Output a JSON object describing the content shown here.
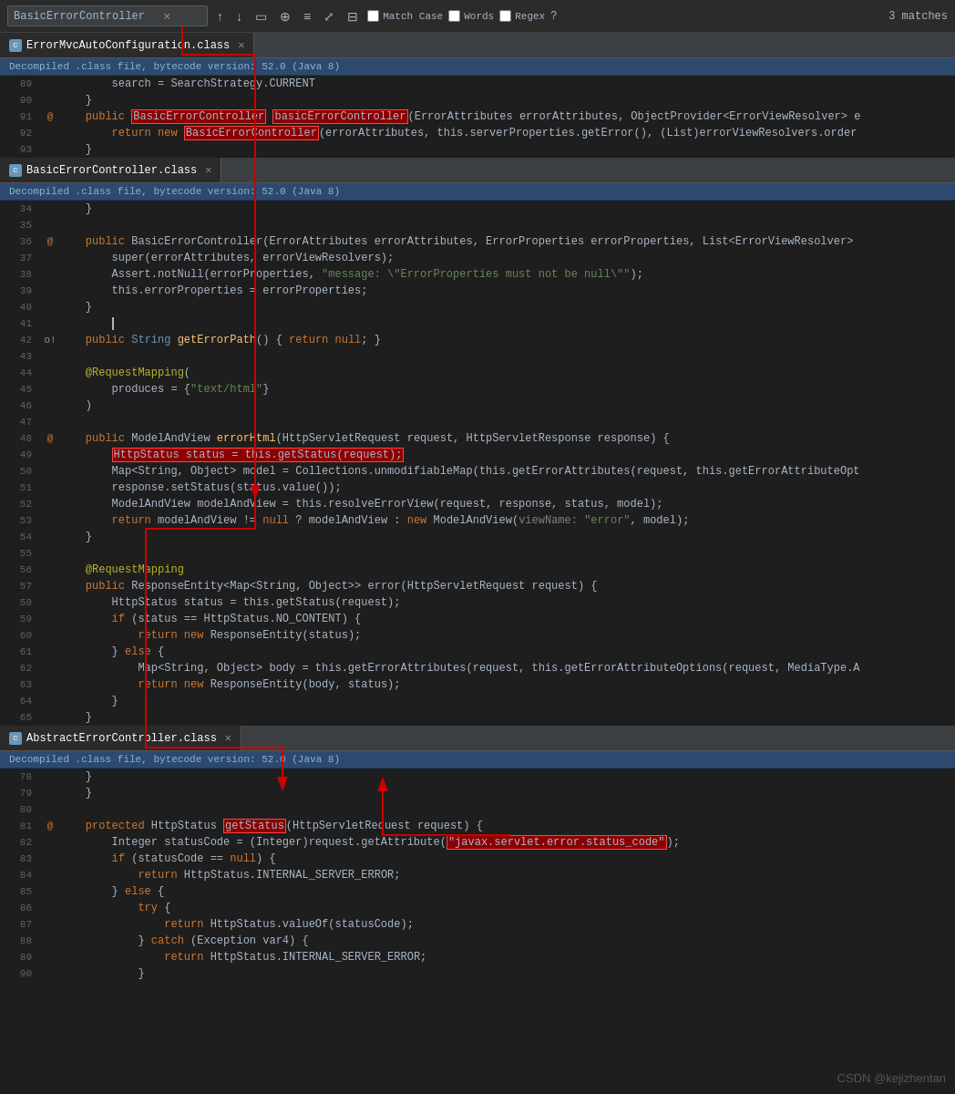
{
  "search": {
    "value": "BasicErrorController",
    "placeholder": "BasicErrorController",
    "match_case_label": "Match Case",
    "words_label": "Words",
    "regex_label": "Regex",
    "matches_label": "3 matches"
  },
  "panels": [
    {
      "tab_title": "ErrorMvcAutoConfiguration.class",
      "info": "Decompiled .class file, bytecode version: 52.0 (Java 8)",
      "lines": [
        {
          "num": 89,
          "gutter": "",
          "content": "        search = SearchStrategy.CURRENT"
        },
        {
          "num": 90,
          "gutter": "",
          "content": "    }"
        },
        {
          "num": 91,
          "gutter": "@",
          "content_raw": "    public <hl>BasicErrorController</hl> <hl2>basicErrorController</hl2>(ErrorAttributes errorAttributes, ObjectProvider<ErrorViewResolver> e"
        },
        {
          "num": 92,
          "gutter": "",
          "content_raw": "        return new <hl>BasicErrorController</hl>(errorAttributes, this.serverProperties.getError(), (List)errorViewResolvers.order"
        },
        {
          "num": 93,
          "gutter": "",
          "content": "    }"
        }
      ]
    },
    {
      "tab_title": "BasicErrorController.class",
      "info": "Decompiled .class file, bytecode version: 52.0 (Java 8)",
      "lines": [
        {
          "num": 34,
          "gutter": "",
          "content": "    }"
        },
        {
          "num": 35,
          "gutter": "",
          "content": ""
        },
        {
          "num": 36,
          "gutter": "@",
          "content_raw": "    public BasicErrorController(ErrorAttributes errorAttributes, ErrorProperties errorProperties, List<ErrorViewResolver>"
        },
        {
          "num": 37,
          "gutter": "",
          "content": "        super(errorAttributes, errorViewResolvers);"
        },
        {
          "num": 38,
          "gutter": "",
          "content_raw": "        Assert.notNull(errorProperties, <str>\"message: \\\"ErrorProperties must not be null\\\"\"</str>);"
        },
        {
          "num": 39,
          "gutter": "",
          "content": "        this.errorProperties = errorProperties;"
        },
        {
          "num": 40,
          "gutter": "",
          "content": "    }"
        },
        {
          "num": 41,
          "gutter": "",
          "content": ""
        },
        {
          "num": 42,
          "gutter": "o!",
          "content_raw": "    public String <method>getErrorPath</method>() { return null; }"
        },
        {
          "num": 43,
          "gutter": "",
          "content": ""
        },
        {
          "num": 44,
          "gutter": "",
          "content_raw": "    <ann>@RequestMapping</ann>("
        },
        {
          "num": 45,
          "gutter": "",
          "content_raw": "        produces = {<str>\"text/html\"</str>}"
        },
        {
          "num": 46,
          "gutter": "",
          "content": "    )"
        },
        {
          "num": 47,
          "gutter": "",
          "content": ""
        },
        {
          "num": 48,
          "gutter": "@",
          "content_raw": "    public ModelAndView <method>errorHtml</method>(HttpServletRequest request, HttpServletResponse response) {"
        },
        {
          "num": 49,
          "gutter": "",
          "content_raw": "        <hl-red>HttpStatus status = this.getStatus(request);</hl-red>"
        },
        {
          "num": 50,
          "gutter": "",
          "content_raw": "        Map<String, Object> model = Collections.unmodifiableMap(this.getErrorAttributes(request, this.getErrorAttributeOpt"
        },
        {
          "num": 51,
          "gutter": "",
          "content": "        response.setStatus(status.value());"
        },
        {
          "num": 52,
          "gutter": "",
          "content": "        ModelAndView modelAndView = this.resolveErrorView(request, response, status, model);"
        },
        {
          "num": 53,
          "gutter": "",
          "content_raw": "        return modelAndView != null ? modelAndView : new ModelAndView(<comment>viewName: </comment><str>\"error\"</str>, model);"
        },
        {
          "num": 54,
          "gutter": "",
          "content": "    }"
        },
        {
          "num": 55,
          "gutter": "",
          "content": ""
        },
        {
          "num": 56,
          "gutter": "",
          "content_raw": "    <ann>@RequestMapping</ann>"
        },
        {
          "num": 57,
          "gutter": "",
          "content": "    public ResponseEntity<Map<String, Object>> error(HttpServletRequest request) {"
        },
        {
          "num": 58,
          "gutter": "",
          "content": "        HttpStatus status = this.getStatus(request);"
        },
        {
          "num": 59,
          "gutter": "",
          "content": "        if (status == HttpStatus.NO_CONTENT) {"
        },
        {
          "num": 60,
          "gutter": "",
          "content": "            return new ResponseEntity(status);"
        },
        {
          "num": 61,
          "gutter": "",
          "content": "        } else {"
        },
        {
          "num": 62,
          "gutter": "",
          "content": "            Map<String, Object> body = this.getErrorAttributes(request, this.getErrorAttributeOptions(request, MediaType.A"
        },
        {
          "num": 63,
          "gutter": "",
          "content": "            return new ResponseEntity(body, status);"
        },
        {
          "num": 64,
          "gutter": "",
          "content": "        }"
        },
        {
          "num": 65,
          "gutter": "",
          "content": "    }"
        }
      ]
    },
    {
      "tab_title": "AbstractErrorController.class",
      "info": "Decompiled .class file, bytecode version: 52.0 (Java 8)",
      "lines": [
        {
          "num": 78,
          "gutter": "",
          "content": "    }"
        },
        {
          "num": 79,
          "gutter": "",
          "content": ""
        },
        {
          "num": 80,
          "gutter": "",
          "content": ""
        },
        {
          "num": 81,
          "gutter": "@",
          "content_raw": "    protected HttpStatus <hl-red>getStatus</hl-red>(HttpServletRequest request) {"
        },
        {
          "num": 82,
          "gutter": "",
          "content_raw": "        Integer statusCode = (Integer)request.getAttribute(<hl-red>\"javax.servlet.error.status_code\"</hl-red>);"
        },
        {
          "num": 83,
          "gutter": "",
          "content": "        if (statusCode == null) {"
        },
        {
          "num": 84,
          "gutter": "",
          "content": "            return HttpStatus.INTERNAL_SERVER_ERROR;"
        },
        {
          "num": 85,
          "gutter": "",
          "content": "        } else {"
        },
        {
          "num": 86,
          "gutter": "",
          "content": "            try {"
        },
        {
          "num": 87,
          "gutter": "",
          "content": "                return HttpStatus.valueOf(statusCode);"
        },
        {
          "num": 88,
          "gutter": "",
          "content": "            } catch (Exception var4) {"
        },
        {
          "num": 89,
          "gutter": "",
          "content": "                return HttpStatus.INTERNAL_SERVER_ERROR;"
        },
        {
          "num": 90,
          "gutter": "",
          "content": "            }"
        }
      ]
    }
  ],
  "watermark": "CSDN @kejizhentan"
}
